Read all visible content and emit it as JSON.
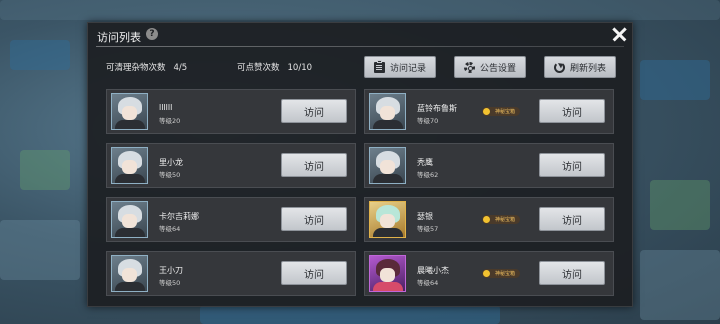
{
  "header": {
    "title": "访问列表"
  },
  "stats": {
    "clean_label": "可清理杂物次数",
    "clean_value": "4/5",
    "like_label": "可点赞次数",
    "like_value": "10/10"
  },
  "toolbar": {
    "visit_record": "访问记录",
    "notice_settings": "公告设置",
    "refresh_list": "刷新列表"
  },
  "players": [
    {
      "name": "llllll",
      "level": "等级20",
      "badge": "",
      "visit_label": "访问",
      "avatar": "silver"
    },
    {
      "name": "蓝铃布鲁斯",
      "level": "等级70",
      "badge": "神秘宝箱",
      "visit_label": "访问",
      "avatar": "silver"
    },
    {
      "name": "里小龙",
      "level": "等级50",
      "badge": "",
      "visit_label": "访问",
      "avatar": "silver"
    },
    {
      "name": "秃鹰",
      "level": "等级62",
      "badge": "",
      "visit_label": "访问",
      "avatar": "silver"
    },
    {
      "name": "卡尔吉莉娜",
      "level": "等级64",
      "badge": "",
      "visit_label": "访问",
      "avatar": "silver"
    },
    {
      "name": "瑟银",
      "level": "等级57",
      "badge": "神秘宝箱",
      "visit_label": "访问",
      "avatar": "gold"
    },
    {
      "name": "王小刀",
      "level": "等级50",
      "badge": "",
      "visit_label": "访问",
      "avatar": "silver"
    },
    {
      "name": "晨曦小杰",
      "level": "等级64",
      "badge": "神秘宝箱",
      "visit_label": "访问",
      "avatar": "purple"
    }
  ],
  "icons": {
    "help": "question-icon",
    "close": "close-icon",
    "record": "document-icon",
    "settings": "gear-icon",
    "refresh": "refresh-icon"
  }
}
